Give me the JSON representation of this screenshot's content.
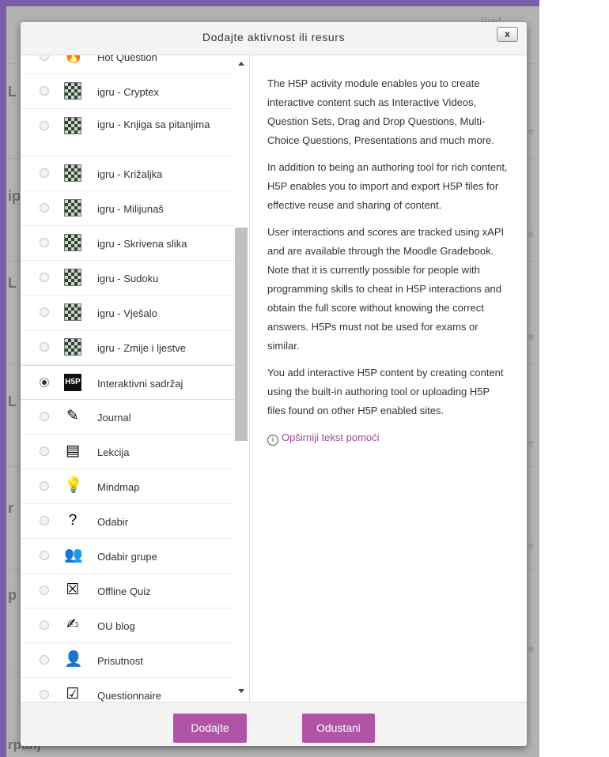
{
  "background": {
    "left_letters": [
      "L",
      "ip",
      "L",
      "L",
      "r",
      "p"
    ],
    "right_fragment": "e",
    "top_right_fragment": "Pređ",
    "bottom_text": "rpanj"
  },
  "dialog": {
    "title": "Dodajte aktivnost ili resurs",
    "close_label": "x"
  },
  "options": [
    {
      "label": "Hot Question",
      "icon": "hot-question-icon"
    },
    {
      "label": "igru - Cryptex",
      "icon": "game-icon"
    },
    {
      "label": "igru - Knjiga sa pitanjima",
      "icon": "game-icon"
    },
    {
      "label": "igru - Križaljka",
      "icon": "game-icon"
    },
    {
      "label": "igru - Milijunaš",
      "icon": "game-icon"
    },
    {
      "label": "igru - Skrivena slika",
      "icon": "game-icon"
    },
    {
      "label": "igru - Sudoku",
      "icon": "game-icon"
    },
    {
      "label": "igru - Vješalo",
      "icon": "game-icon"
    },
    {
      "label": "igru - Zmije i ljestve",
      "icon": "game-icon"
    },
    {
      "label": "Interaktivni sadržaj",
      "icon": "h5p-icon",
      "icon_text": "H5P",
      "selected": true
    },
    {
      "label": "Journal",
      "icon": "journal-icon"
    },
    {
      "label": "Lekcija",
      "icon": "lesson-icon"
    },
    {
      "label": "Mindmap",
      "icon": "mindmap-icon"
    },
    {
      "label": "Odabir",
      "icon": "choice-icon"
    },
    {
      "label": "Odabir grupe",
      "icon": "group-choice-icon"
    },
    {
      "label": "Offline Quiz",
      "icon": "offline-quiz-icon"
    },
    {
      "label": "OU blog",
      "icon": "blog-icon"
    },
    {
      "label": "Prisutnost",
      "icon": "attendance-icon"
    },
    {
      "label": "Questionnaire",
      "icon": "questionnaire-icon"
    }
  ],
  "help": {
    "paragraphs": [
      "The H5P activity module enables you to create interactive content such as Interactive Videos, Question Sets, Drag and Drop Questions, Multi-Choice Questions, Presentations and much more.",
      "In addition to being an authoring tool for rich content, H5P enables you to import and export H5P files for effective reuse and sharing of content.",
      "User interactions and scores are tracked using xAPI and are available through the Moodle Gradebook. Note that it is currently possible for people with programming skills to cheat in H5P interactions and obtain the full score without knowing the correct answers. H5Ps must not be used for exams or similar.",
      "You add interactive H5P content by creating content using the built-in authoring tool or uploading H5P files found on other H5P enabled sites."
    ],
    "more_help_link": "Opširniji tekst pomoći"
  },
  "footer": {
    "add_label": "Dodajte",
    "cancel_label": "Odustani"
  },
  "colors": {
    "frame": "#7b5ea7",
    "button": "#b154a6",
    "link": "#a1469e"
  }
}
